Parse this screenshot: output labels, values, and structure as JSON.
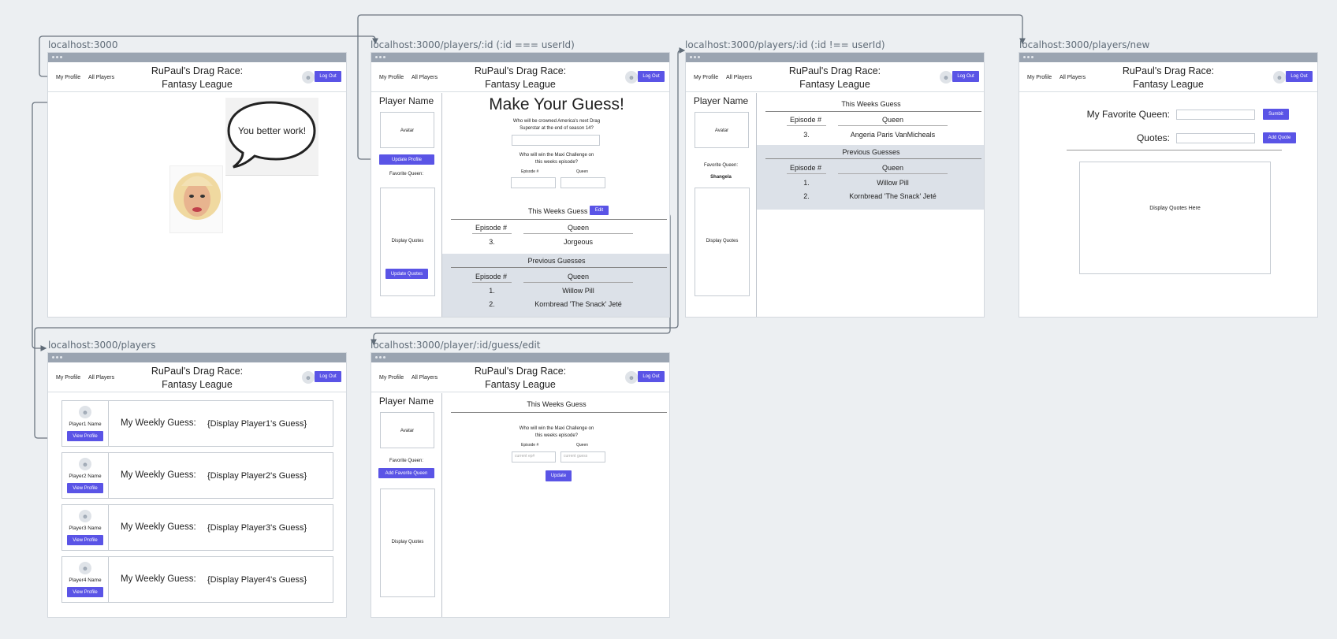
{
  "urls": {
    "home": "localhost:3000",
    "self": "localhost:3000/players/:id (:id === userId)",
    "other": "localhost:3000/players/:id (:id !== userId)",
    "new": "localhost:3000/players/new",
    "index": "localhost:3000/players",
    "edit": "localhost:3000/player/:id/guess/edit"
  },
  "nav": {
    "my_profile": "My Profile",
    "all_players": "All Players",
    "title_line1": "RuPaul's Drag Race:",
    "title_line2": "Fantasy League",
    "logout": "Log Out"
  },
  "home": {
    "speech": "You better work!"
  },
  "self_page": {
    "player_name": "Player Name",
    "avatar": "Avatar",
    "update_profile": "Update Profile",
    "favorite_queen": "Favorite Queen:",
    "display_quotes": "Display Quotes",
    "update_quotes": "Update Quotes",
    "heading": "Make Your Guess!",
    "q1_line1": "Who will be crowned America's next Drag",
    "q1_line2": "Superstar at the end of season 14?",
    "q2_line1": "Who will win the Maxi Challenge on",
    "q2_line2": "this weeks episode?",
    "episode_label": "Episode #",
    "queen_label": "Queen",
    "this_week": "This Weeks Guess",
    "edit": "Edit",
    "col_episode": "Episode #",
    "col_queen": "Queen",
    "this_week_rows": [
      {
        "ep": "3.",
        "queen": "Jorgeous"
      }
    ],
    "previous": "Previous Guesses",
    "previous_rows": [
      {
        "ep": "1.",
        "queen": "Willow Pill"
      },
      {
        "ep": "2.",
        "queen": "Kornbread 'The Snack' Jeté"
      }
    ]
  },
  "other_page": {
    "player_name": "Player Name",
    "avatar": "Avatar",
    "favorite_queen": "Favorite Queen:",
    "favorite_value": "Shangela",
    "display_quotes": "Display Quotes",
    "this_week": "This Weeks Guess",
    "col_episode": "Episode #",
    "col_queen": "Queen",
    "this_week_rows": [
      {
        "ep": "3.",
        "queen": "Angeria Paris VanMicheals"
      }
    ],
    "previous": "Previous Guesses",
    "previous_rows": [
      {
        "ep": "1.",
        "queen": "Willow Pill"
      },
      {
        "ep": "2.",
        "queen": "Kornbread 'The Snack' Jeté"
      }
    ]
  },
  "new_page": {
    "fav_label": "My Favorite Queen:",
    "submit": "Sumbit",
    "quotes_label": "Quotes:",
    "add_quote": "Add Quote",
    "display_quotes": "Display Quotes Here"
  },
  "index_page": {
    "weekly_label": "My Weekly Guess:",
    "view_profile": "View Profile",
    "players": [
      {
        "name": "Player1 Name",
        "guess": "{Display Player1's Guess}"
      },
      {
        "name": "Player2 Name",
        "guess": "{Display Player2's Guess}"
      },
      {
        "name": "Player3 Name",
        "guess": "{Display Player3's Guess}"
      },
      {
        "name": "Player4 Name",
        "guess": "{Display Player4's Guess}"
      }
    ]
  },
  "edit_page": {
    "player_name": "Player Name",
    "avatar": "Avatar",
    "favorite_queen": "Favorite Queen:",
    "add_favorite": "Add Favorite Queen",
    "display_quotes": "Display Quotes",
    "this_week": "This Weeks Guess",
    "q_line1": "Who will win the Maxi Challenge on",
    "q_line2": "this weeks episode?",
    "episode_label": "Episode #",
    "queen_label": "Queen",
    "ep_placeholder": "current ep#",
    "queen_placeholder": "current guess",
    "update": "Update"
  },
  "colors": {
    "accent": "#5a54e6",
    "chrome": "#9aa4b1",
    "canvas": "#eceff2",
    "highlight": "#dce1e8"
  }
}
